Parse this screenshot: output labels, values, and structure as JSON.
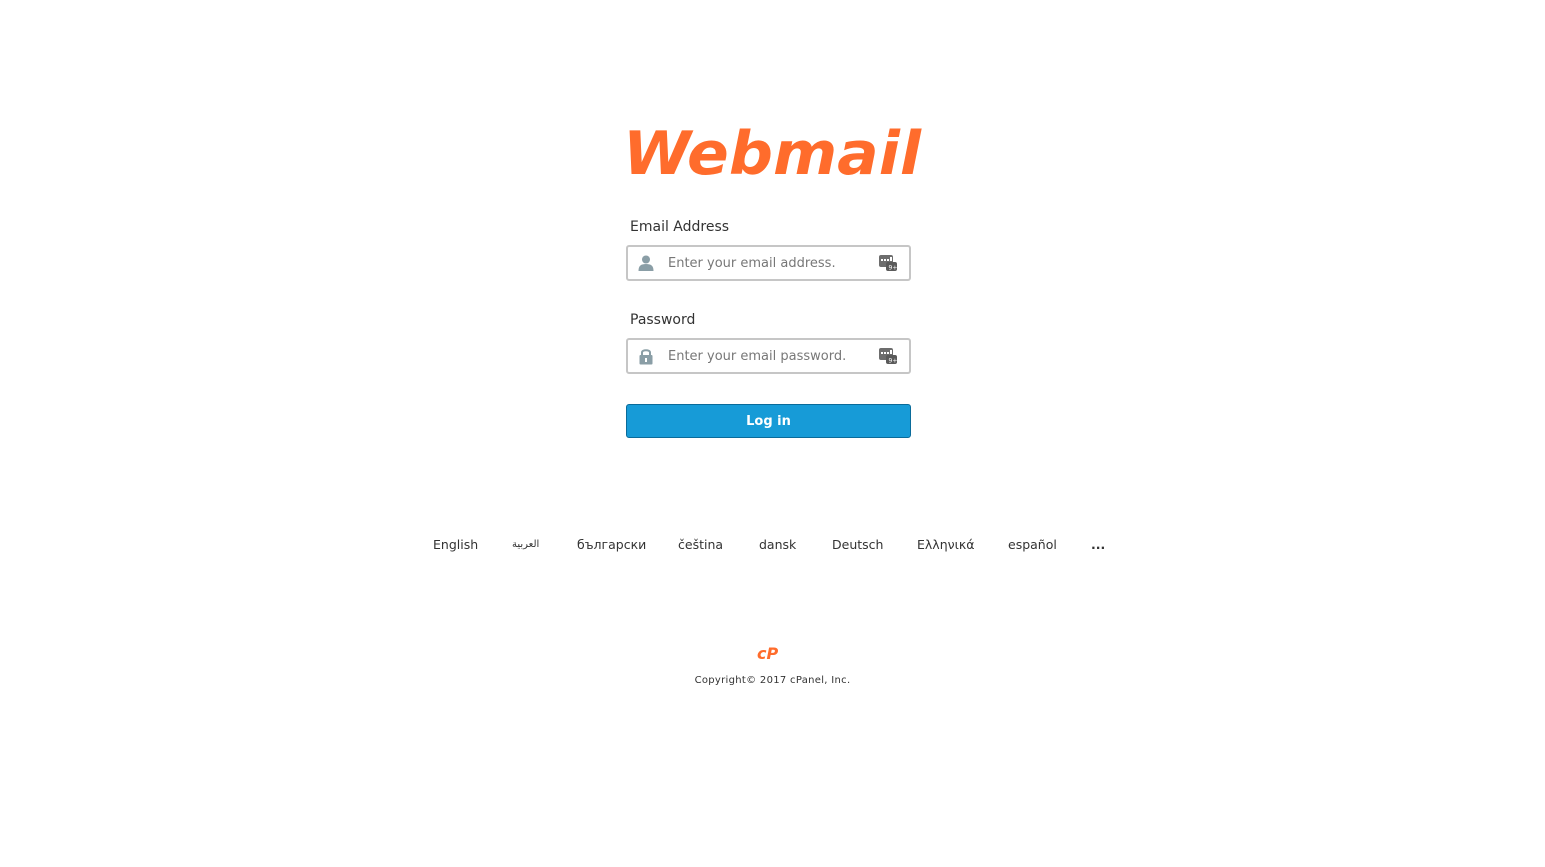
{
  "brand": {
    "logo_text": "Webmail",
    "accent_color": "#ff6c2c",
    "button_color": "#179bd7"
  },
  "login_form": {
    "email": {
      "label": "Email Address",
      "placeholder": "Enter your email address.",
      "value": "",
      "lead_icon": "user-icon",
      "trail_icon": "virtual-keyboard-icon"
    },
    "password": {
      "label": "Password",
      "placeholder": "Enter your email password.",
      "value": "",
      "lead_icon": "lock-icon",
      "trail_icon": "virtual-keyboard-icon"
    },
    "submit_label": "Log in"
  },
  "languages": [
    {
      "label": "English"
    },
    {
      "label": "العربية"
    },
    {
      "label": "български"
    },
    {
      "label": "čeština"
    },
    {
      "label": "dansk"
    },
    {
      "label": "Deutsch"
    },
    {
      "label": "Ελληνικά"
    },
    {
      "label": "español"
    },
    {
      "label": "..."
    }
  ],
  "footer": {
    "logo_text": "cP",
    "copyright": "Copyright© 2017 cPanel, Inc."
  }
}
